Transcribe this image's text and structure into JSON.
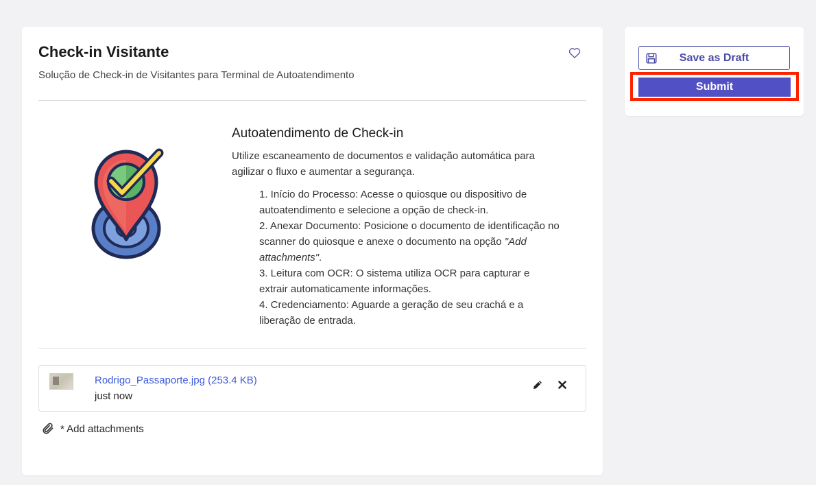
{
  "form": {
    "title": "Check-in Visitante",
    "subtitle": "Solução de Check-in de Visitantes para Terminal de Autoatendimento",
    "section_heading": "Autoatendimento de Check-in",
    "intro": "Utilize escaneamento de documentos e validação automática para agilizar o fluxo e aumentar a segurança.",
    "steps": [
      "1. Início do Processo: Acesse o quiosque ou dispositivo de autoatendimento e selecione a opção de check-in.",
      "2. Anexar Documento: Posicione o documento de identificação no scanner do quiosque e anexe o documento na opção ",
      "3. Leitura com OCR: O sistema utiliza OCR para capturar e extrair automaticamente informações.",
      "4. Credenciamento: Aguarde a geração de seu crachá e a liberação de entrada."
    ],
    "step2_italic": "\"Add attachments\"",
    "step2_end": "."
  },
  "attachment": {
    "file_label": "Rodrigo_Passaporte.jpg (253.4 KB)",
    "time": "just now"
  },
  "add_attachments_label": "* Add attachments",
  "actions": {
    "save_draft_label": "Save as Draft",
    "submit_label": "Submit"
  },
  "colors": {
    "accent": "#5150c4",
    "link": "#3d5bd9",
    "highlight": "#ff2200"
  }
}
